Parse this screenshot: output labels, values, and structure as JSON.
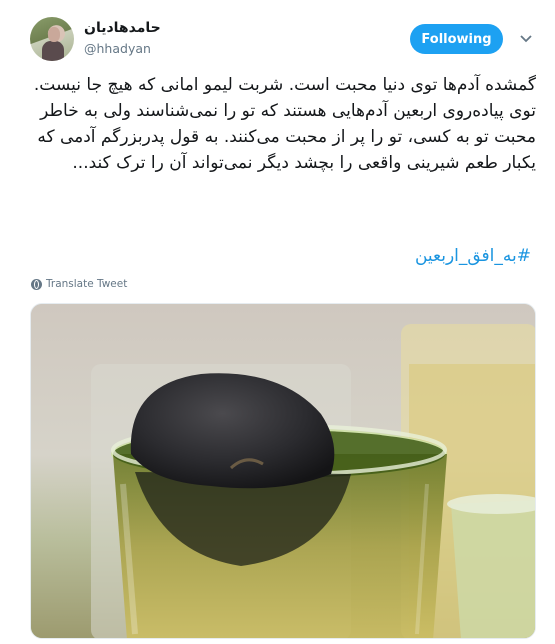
{
  "user": {
    "name": "حامدهادیان",
    "handle": "@hhadyan"
  },
  "follow_button": {
    "label": "Following"
  },
  "tweet": {
    "text": "گمشده آدم‌ها توی دنیا محبت است. شربت لیمو امانی که هیچ جا نیست. توی پیاده‌روی اربعین آدم‌هایی هستند که تو را نمی‌شناسند ولی به خاطر محبت تو به کسی، تو را پر از محبت می‌کنند. به قول پدربزرگم آدمی که یکبار طعم شیرینی واقعی را بچشد دیگر نمی‌تواند آن را ترک کند...",
    "hashtag": "#به_افق_اربعین"
  },
  "translate": {
    "label": "Translate Tweet"
  },
  "icons": {
    "caret": "chevron-down-icon",
    "translate": "globe-icon"
  },
  "colors": {
    "accent": "#1da1f2",
    "hashtag": "#1b95e0",
    "secondary_text": "#657786"
  }
}
